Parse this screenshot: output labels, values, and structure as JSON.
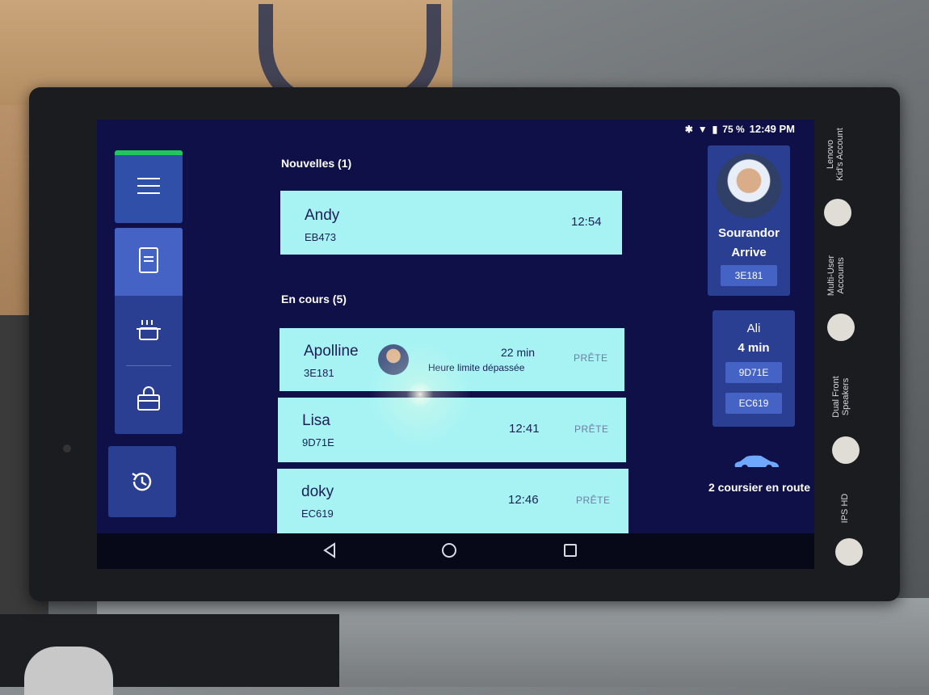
{
  "status_bar": {
    "battery": "75 %",
    "time": "12:49 PM"
  },
  "sections": {
    "new": {
      "title": "Nouvelles (1)"
    },
    "in_progress": {
      "title": "En cours (5)"
    }
  },
  "new_orders": [
    {
      "name": "Andy",
      "code": "EB473",
      "time": "12:54"
    }
  ],
  "in_progress_orders": [
    {
      "name": "Apolline",
      "code": "3E181",
      "time": "22 min",
      "subtext": "Heure limite dépassée",
      "status": "PRÊTE"
    },
    {
      "name": "Lisa",
      "code": "9D71E",
      "time": "12:41",
      "status": "PRÊTE"
    },
    {
      "name": "doky",
      "code": "EC619",
      "time": "12:46",
      "status": "PRÊTE"
    }
  ],
  "arriving_driver": {
    "name": "Sourandor",
    "state": "Arrive",
    "order": "3E181"
  },
  "incoming_courier": {
    "name": "Ali",
    "eta": "4 min",
    "orders": [
      "9D71E",
      "EC619"
    ]
  },
  "couriers_en_route": "2 coursier en route",
  "bezel_labels": {
    "kids": "Lenovo\nKid's Account",
    "multi": "Multi-User\nAccounts",
    "speakers": "Dual Front\nSpeakers",
    "ips": "IPS HD"
  },
  "colors": {
    "screen_bg": "#0f1048",
    "card_bg": "#a7f3f4",
    "nav_active": "#4463c4",
    "accent_green": "#22c55e"
  }
}
